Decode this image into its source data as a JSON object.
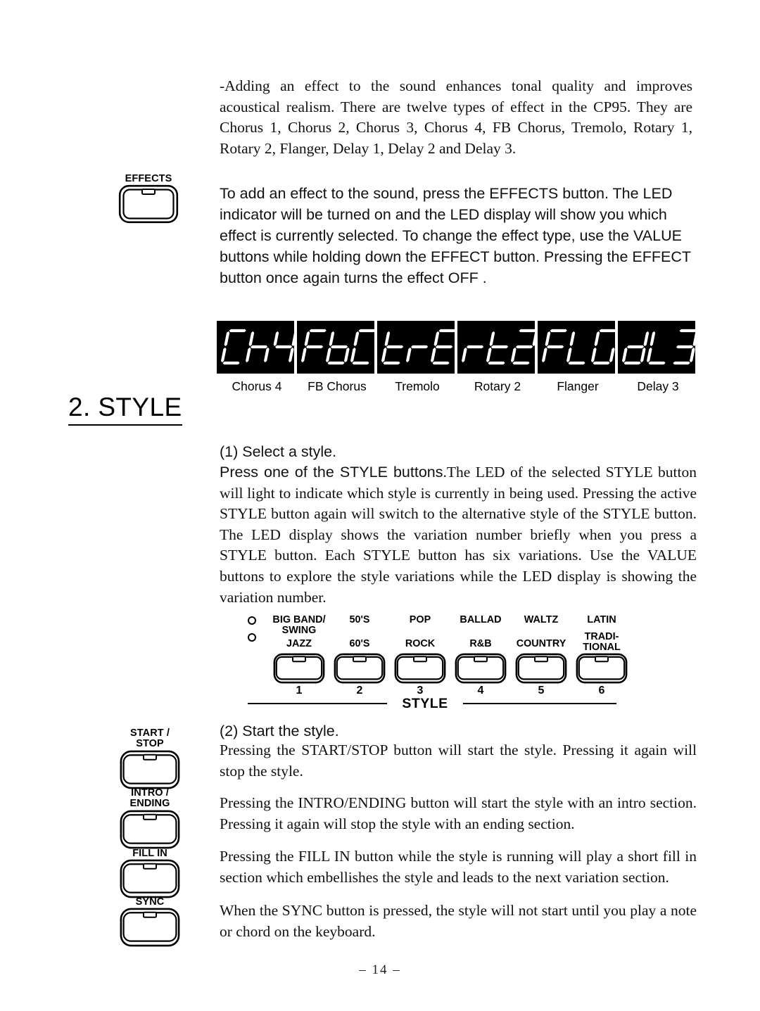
{
  "document": {
    "page_number": "–  14  –"
  },
  "effects_section": {
    "intro_paragraph": "-Adding an effect to the sound enhances tonal quality and improves acoustical realism. There are twelve types of effect in the CP95.  They are Chorus 1, Chorus 2, Chorus 3, Chorus 4, FB Chorus, Tremolo, Rotary 1, Rotary 2, Flanger, Delay 1, Delay 2 and Delay 3.",
    "howto_paragraph": "To add an effect to the sound, press the EFFECTS button.  The LED indicator will be turned on and the LED display will show you which effect is currently selected. To change the effect type, use the VALUE buttons while holding down the EFFECT button. Pressing the EFFECT button once again turns the effect  OFF .",
    "effects_button_label": "EFFECTS",
    "led_display": {
      "items": [
        {
          "segments": "Ch4",
          "caption": "Chorus 4"
        },
        {
          "segments": "FbC",
          "caption": "FB Chorus"
        },
        {
          "segments": "trE",
          "caption": "Tremolo"
        },
        {
          "segments": "rt2",
          "caption": "Rotary 2"
        },
        {
          "segments": "FLG",
          "caption": "Flanger"
        },
        {
          "segments": "dL3",
          "caption": "Delay 3"
        }
      ]
    }
  },
  "style_section": {
    "heading": "2. STYLE",
    "select_style_heading": "(1) Select a style.",
    "select_style_lead_sans": "Press one of the STYLE buttons",
    "select_style_body_serif": ".The LED of the selected STYLE button will light to indicate which style is currently in being used.  Pressing the active STYLE button again will switch to the alternative style of the STYLE button.  The LED display shows the variation number briefly when you press a STYLE button.  Each STYLE button has six variations.  Use the VALUE buttons to explore the style variations while the LED display is showing the variation number.",
    "start_style_heading": "(2) Start the style.",
    "startstop_paragraph": "Pressing the START/STOP button will start the style.  Pressing it again will stop the style.",
    "introending_paragraph": "Pressing the INTRO/ENDING button will start the style with an intro section.  Pressing it again will stop the style with an ending section.",
    "fillin_paragraph": "Pressing the FILL IN button while the style is running will play a short fill in section which embellishes the style and leads to the next variation section.",
    "sync_paragraph": "When the SYNC button is pressed, the style will not start until you play a note or chord on the keyboard.",
    "panel": {
      "group_label": "STYLE",
      "buttons": [
        {
          "top_label": "BIG BAND/\nSWING",
          "bottom_label": "JAZZ",
          "number": "1"
        },
        {
          "top_label": "50'S",
          "bottom_label": "60'S",
          "number": "2"
        },
        {
          "top_label": "POP",
          "bottom_label": "ROCK",
          "number": "3"
        },
        {
          "top_label": "BALLAD",
          "bottom_label": "R&B",
          "number": "4"
        },
        {
          "top_label": "WALTZ",
          "bottom_label": "COUNTRY",
          "number": "5"
        },
        {
          "top_label": "LATIN",
          "bottom_label": "TRADI-\nTIONAL",
          "number": "6"
        }
      ]
    },
    "transport_buttons": [
      {
        "label": "START /\nSTOP"
      },
      {
        "label": "INTRO /\nENDING"
      },
      {
        "label": "FILL IN"
      },
      {
        "label": "SYNC"
      }
    ]
  },
  "colors": {
    "ink": "#000000",
    "paper": "#ffffff",
    "led_background": "#000000",
    "led_segment": "#ffffff"
  }
}
